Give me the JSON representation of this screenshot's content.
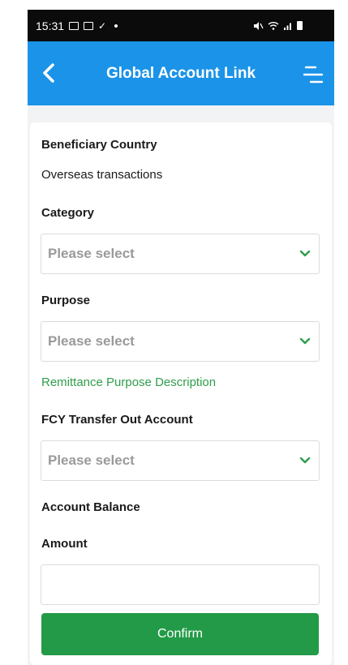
{
  "status_bar": {
    "time": "15:31"
  },
  "header": {
    "title": "Global Account Link"
  },
  "form": {
    "beneficiary_country_label": "Beneficiary Country",
    "beneficiary_country_value": "Overseas transactions",
    "category_label": "Category",
    "category_placeholder": "Please select",
    "purpose_label": "Purpose",
    "purpose_placeholder": "Please select",
    "purpose_description_link": "Remittance Purpose Description",
    "fcy_account_label": "FCY Transfer Out Account",
    "fcy_account_placeholder": "Please select",
    "account_balance_label": "Account Balance",
    "amount_label": "Amount",
    "amount_value": ""
  },
  "actions": {
    "confirm_label": "Confirm"
  },
  "colors": {
    "header_blue": "#1a93e8",
    "confirm_green": "#239a47",
    "link_green": "#2f9e4a",
    "placeholder_gray": "#9a9a9a",
    "chevron_green": "#2f9e4a"
  },
  "icons": {
    "back": "chevron-left-icon",
    "menu": "menu-icon",
    "dropdown": "chevron-down-icon"
  }
}
